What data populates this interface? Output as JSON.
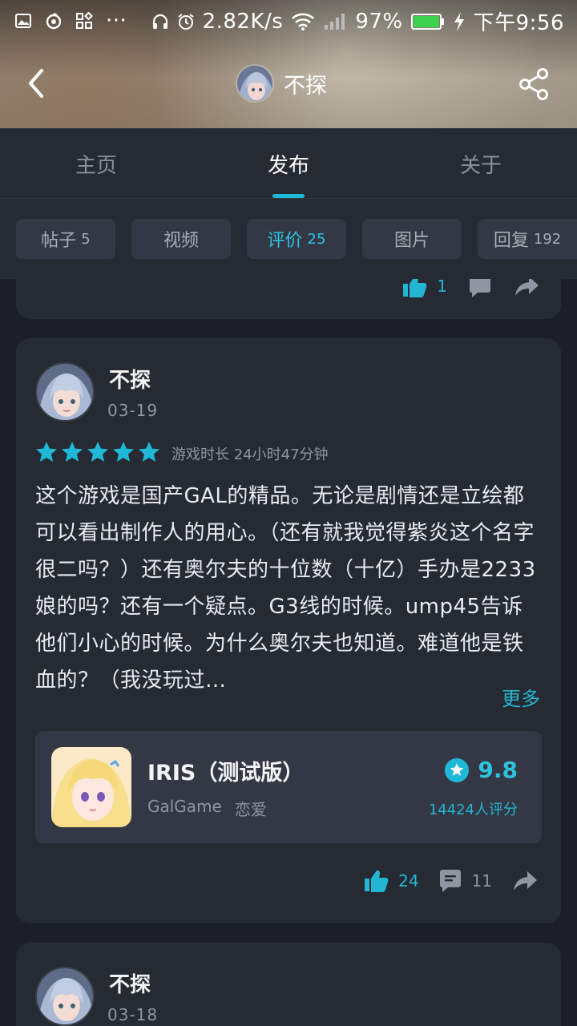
{
  "statusbar": {
    "speed": "2.82K/s",
    "battery": "97%",
    "time": "下午9:56",
    "more": "···"
  },
  "nav": {
    "username": "不探"
  },
  "tabs": [
    {
      "label": "主页"
    },
    {
      "label": "发布"
    },
    {
      "label": "关于"
    }
  ],
  "chips": [
    {
      "label": "帖子",
      "count": "5"
    },
    {
      "label": "视频",
      "count": ""
    },
    {
      "label": "评价",
      "count": "25"
    },
    {
      "label": "图片",
      "count": ""
    },
    {
      "label": "回复",
      "count": "192"
    }
  ],
  "prev_card": {
    "likes": "1"
  },
  "review": {
    "author": "不探",
    "date": "03-19",
    "rating": 5,
    "playtime": "游戏时长 24小时47分钟",
    "text": "这个游戏是国产GAL的精品。无论是剧情还是立绘都可以看出制作人的用心。（还有就我觉得紫炎这个名字很二吗？）还有奥尔夫的十位数（十亿）手办是2233娘的吗？还有一个疑点。G3线的时候。ump45告诉他们小心的时候。为什么奥尔夫也知道。难道他是铁血的？（我没玩过…",
    "more": "更多",
    "game": {
      "title": "IRIS（测试版）",
      "tag1": "GalGame",
      "tag2": "恋爱",
      "score": "9.8",
      "ratings": "14424人评分"
    },
    "likes": "24",
    "comments": "11"
  },
  "next_card": {
    "author": "不探",
    "date": "03-18"
  },
  "colors": {
    "accent": "#23b6d3",
    "background": "#1d1f27",
    "card": "#262a33"
  }
}
